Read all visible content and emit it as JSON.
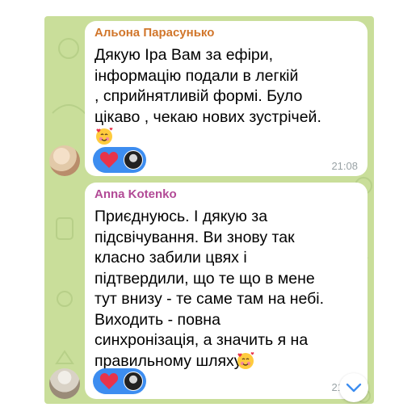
{
  "colors": {
    "chat_background": "#c9de9a",
    "bubble": "#ffffff",
    "sender1": "#d1762b",
    "sender2": "#b24a96",
    "reaction_pill": "#3d8df0",
    "heart": "#e8334a",
    "time": "#9aa3a6"
  },
  "messages": [
    {
      "sender": "Альона Парасунько",
      "text": "Дякую Іра Вам за ефіри,\nінформацію подали в легкій\n, сприйнятливій формі. Було\nцікаво , чекаю нових зустрічей.",
      "emoji": "smiling-face-with-hearts",
      "reaction": "heart",
      "time": "21:08"
    },
    {
      "sender": "Anna Kotenko",
      "text": "Приєднуюсь. І дякую за\nпідсвічування. Ви знову так\nкласно забили цвях і\nпідтвердили, що те що в мене\nтут внизу - те саме там на небі.\nВиходить - повна\nсинхронізація, а значить я на\nправильному шляху",
      "emoji": "smiling-face-with-hearts",
      "reaction": "heart",
      "time": "21:16"
    }
  ],
  "icons": {
    "scroll_down": "chevron-down-icon",
    "reaction": "heart-icon",
    "emoji": "smiling-face-with-hearts-icon"
  }
}
